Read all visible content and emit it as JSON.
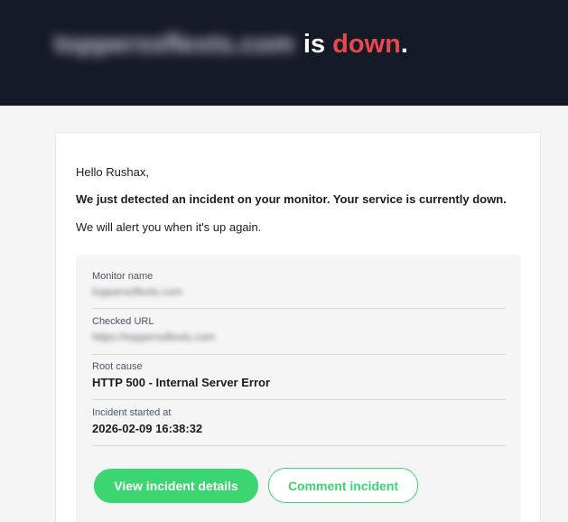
{
  "header": {
    "domain": "topperssflexts.com",
    "is_label": "is",
    "status": "down",
    "period": "."
  },
  "message": {
    "greeting": "Hello Rushax,",
    "headline": "We just detected an incident on your monitor. Your service is currently down.",
    "note": "We will alert you when it's up again."
  },
  "details": [
    {
      "label": "Monitor name",
      "value": "topperssflexts.com"
    },
    {
      "label": "Checked URL",
      "value": "https://topperssflexts.com"
    },
    {
      "label": "Root cause",
      "value": "HTTP 500 - Internal Server Error"
    },
    {
      "label": "Incident started at",
      "value": "2026-02-09 16:38:32"
    }
  ],
  "actions": {
    "view_details": "View incident details",
    "comment": "Comment incident"
  },
  "colors": {
    "banner_bg": "#151a27",
    "status_red": "#e5484d",
    "accent_green": "#3bd671",
    "panel_bg": "#f5f5f5"
  }
}
